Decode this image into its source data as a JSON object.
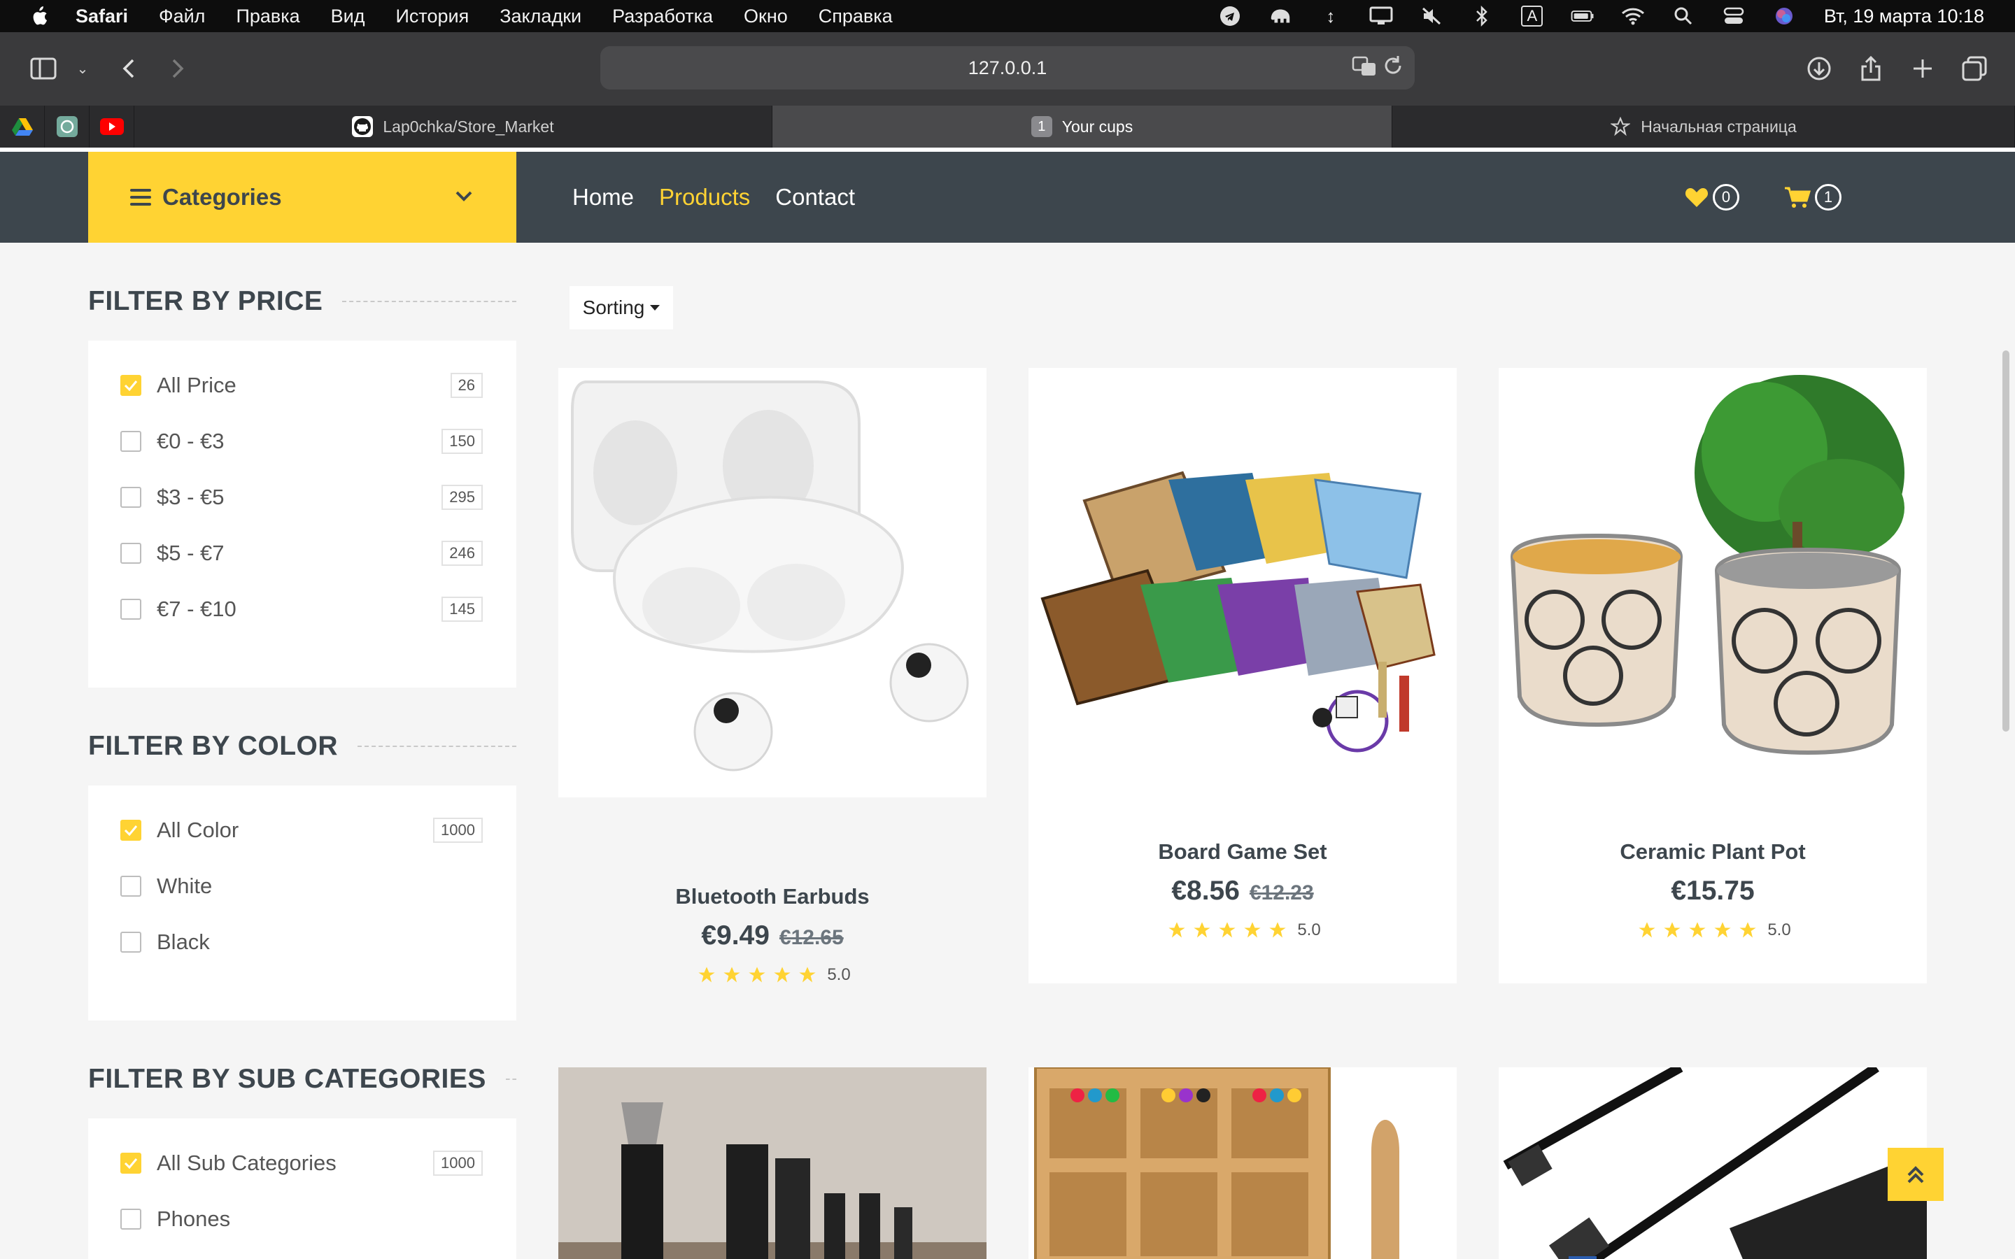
{
  "menubar": {
    "app_name": "Safari",
    "items": [
      "Файл",
      "Правка",
      "Вид",
      "История",
      "Закладки",
      "Разработка",
      "Окно",
      "Справка"
    ],
    "input_indicator": "A",
    "clock": "Вт, 19 марта  10:18"
  },
  "browser": {
    "url": "127.0.0.1",
    "tabs": [
      {
        "label": "Lap0chka/Store_Market",
        "icon": "github-icon"
      },
      {
        "label": "Your cups",
        "badge": "1",
        "active": true
      },
      {
        "label": "Начальная страница",
        "icon": "star-icon"
      }
    ]
  },
  "nav": {
    "categories_label": "Categories",
    "links": [
      "Home",
      "Products",
      "Contact"
    ],
    "active_link": "Products",
    "wishlist_count": "0",
    "cart_count": "1"
  },
  "filters": {
    "price": {
      "title": "FILTER BY PRICE",
      "options": [
        {
          "label": "All Price",
          "count": "26",
          "checked": true
        },
        {
          "label": "€0 - €3",
          "count": "150",
          "checked": false
        },
        {
          "label": "$3 - €5",
          "count": "295",
          "checked": false
        },
        {
          "label": "$5 - €7",
          "count": "246",
          "checked": false
        },
        {
          "label": "€7 - €10",
          "count": "145",
          "checked": false
        }
      ]
    },
    "color": {
      "title": "FILTER BY COLOR",
      "options": [
        {
          "label": "All Color",
          "count": "1000",
          "checked": true
        },
        {
          "label": "White",
          "checked": false
        },
        {
          "label": "Black",
          "checked": false
        }
      ]
    },
    "sub": {
      "title": "FILTER BY SUB CATEGORIES",
      "options": [
        {
          "label": "All Sub Categories",
          "count": "1000",
          "checked": true
        },
        {
          "label": "Phones",
          "checked": false
        }
      ]
    }
  },
  "sorting_label": "Sorting",
  "products": [
    {
      "name": "Bluetooth Earbuds",
      "price": "€9.49",
      "old_price": "€12.65",
      "rating": "5.0",
      "stars": 5
    },
    {
      "name": "Board Game Set",
      "price": "€8.56",
      "old_price": "€12.23",
      "rating": "5.0",
      "stars": 5
    },
    {
      "name": "Ceramic Plant Pot",
      "price": "€15.75",
      "old_price": "",
      "rating": "5.0",
      "stars": 5
    }
  ],
  "colors": {
    "accent": "#ffd333",
    "dark": "#3d464d",
    "background": "#f5f5f5"
  }
}
